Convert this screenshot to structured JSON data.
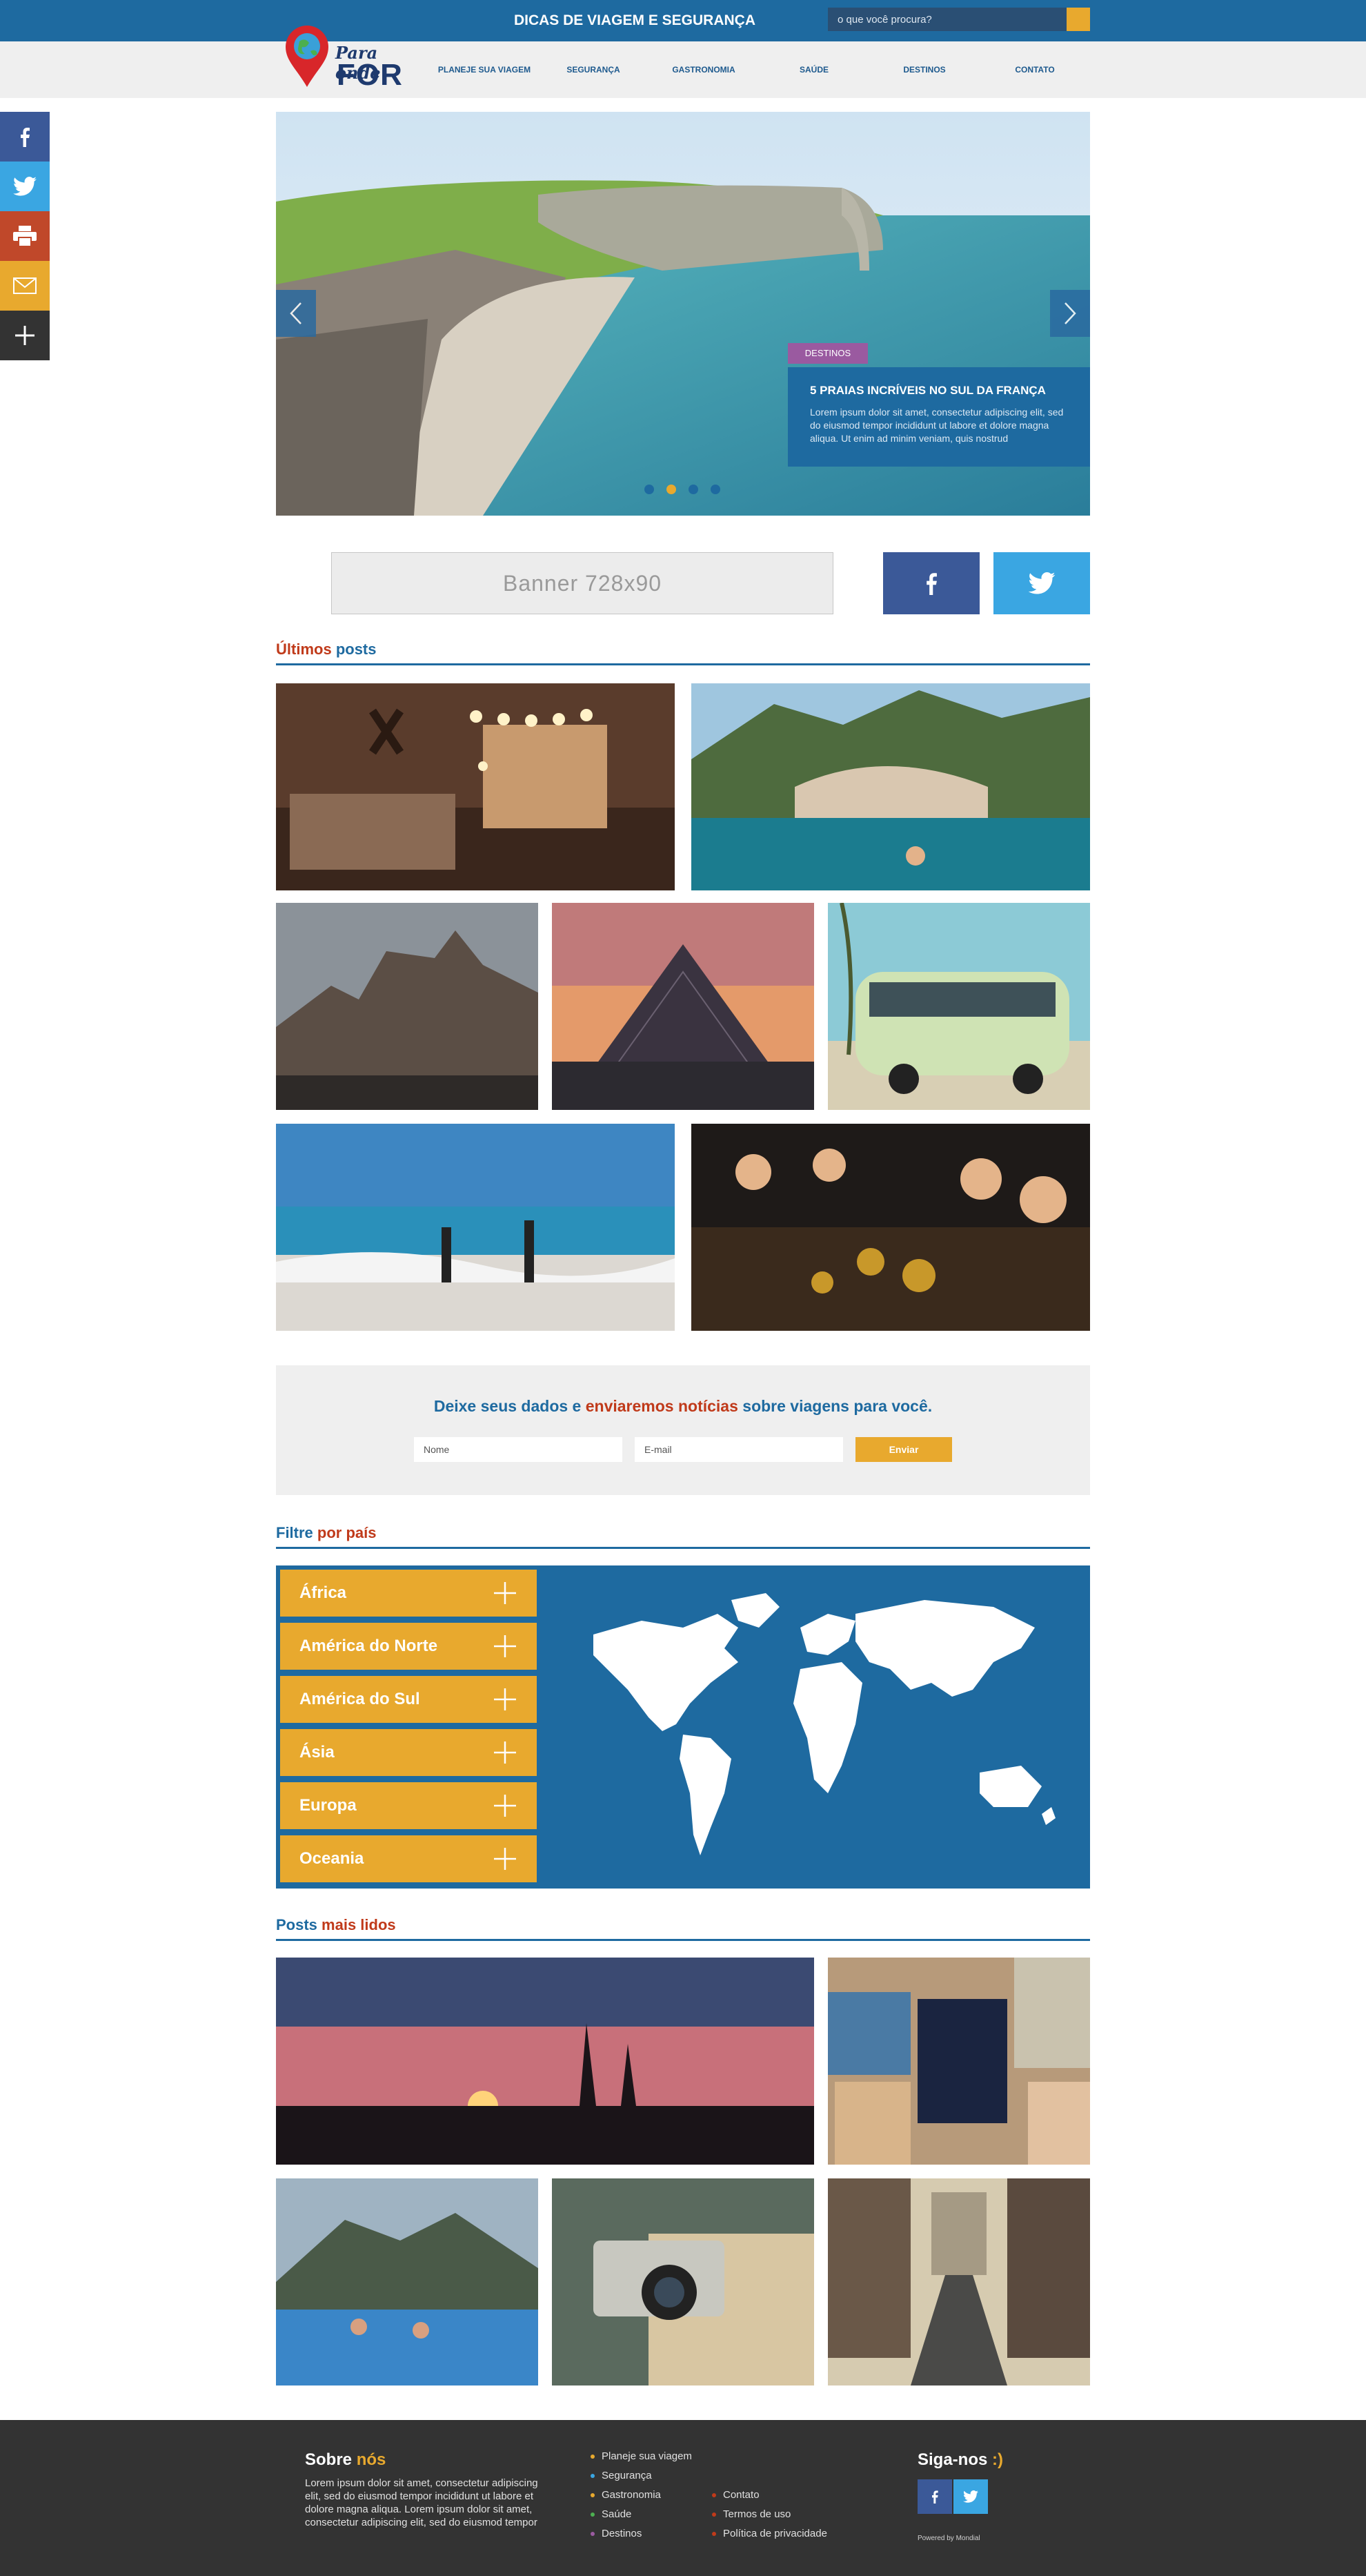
{
  "header": {
    "title": "DICAS DE VIAGEM E SEGURANÇA",
    "search_placeholder": "o que você procura?"
  },
  "logo": {
    "line1": "Para onde",
    "line2": "FOR"
  },
  "nav": {
    "items": [
      "PLANEJE SUA VIAGEM",
      "SEGURANÇA",
      "GASTRONOMIA",
      "SAÚDE",
      "DESTINOS",
      "CONTATO"
    ]
  },
  "social_sidebar": [
    "facebook-icon",
    "twitter-icon",
    "print-icon",
    "mail-icon",
    "plus-icon"
  ],
  "slider": {
    "tag": "DESTINOS",
    "title": "5 PRAIAS INCRÍVEIS NO SUL DA FRANÇA",
    "text": "Lorem ipsum dolor sit amet, consectetur adipiscing elit, sed do eiusmod tempor incididunt ut labore et dolore magna aliqua. Ut enim ad minim veniam, quis nostrud",
    "dots": 4,
    "active_dot": 2
  },
  "banner": {
    "label": "Banner 728x90"
  },
  "latest": {
    "title_a": "Últimos",
    "title_b": "posts"
  },
  "newsletter": {
    "t1": "Deixe seus dados e ",
    "t2": "enviaremos notícias",
    "t3": " sobre viagens para você.",
    "name_placeholder": "Nome",
    "email_placeholder": "E-mail",
    "button": "Enviar"
  },
  "filter": {
    "title_a": "Filtre",
    "title_b": "por país",
    "countries": [
      "África",
      "América do Norte",
      "América do Sul",
      "Ásia",
      "Europa",
      "Oceania"
    ]
  },
  "popular": {
    "title_a": "Posts",
    "title_b": "mais lidos"
  },
  "footer": {
    "about_a": "Sobre",
    "about_b": "nós",
    "about_text": "Lorem ipsum dolor sit amet, consectetur adipiscing elit, sed do eiusmod tempor incididunt ut labore et dolore magna aliqua. Lorem ipsum dolor sit amet, consectetur adipiscing elit, sed do eiusmod tempor",
    "links_col1": [
      "Planeje sua viagem",
      "Segurança",
      "Gastronomia",
      "Saúde",
      "Destinos"
    ],
    "links_col2": [
      "Contato",
      "Termos de uso",
      "Política de privacidade"
    ],
    "follow_a": "Siga-nos",
    "follow_b": ":)",
    "powered": "Powered by Mondial"
  },
  "colors": {
    "primary": "#1e6aa0",
    "accent": "#e8a92e",
    "red": "#c03a1a",
    "footer": "#333333"
  }
}
